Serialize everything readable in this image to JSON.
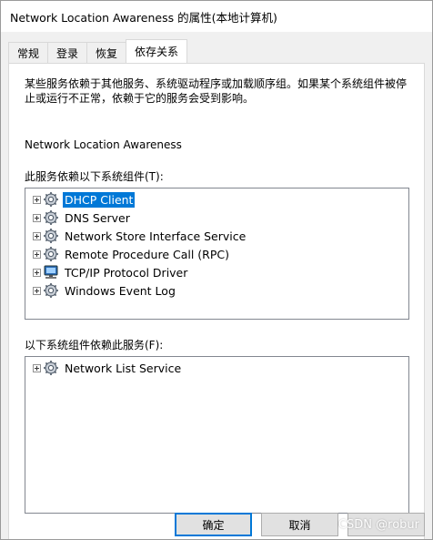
{
  "window": {
    "title": "Network Location Awareness 的属性(本地计算机)"
  },
  "tabs": [
    {
      "label": "常规",
      "active": false
    },
    {
      "label": "登录",
      "active": false
    },
    {
      "label": "恢复",
      "active": false
    },
    {
      "label": "依存关系",
      "active": true
    }
  ],
  "dependencies_tab": {
    "description": "某些服务依赖于其他服务、系统驱动程序或加载顺序组。如果某个系统组件被停止或运行不正常，依赖于它的服务会受到影响。",
    "service_name": "Network Location Awareness",
    "depends_on_label": "此服务依赖以下系统组件(T):",
    "depends_on": [
      {
        "label": "DHCP Client",
        "icon": "gear-service-icon",
        "selected": true
      },
      {
        "label": "DNS Server",
        "icon": "gear-service-icon",
        "selected": false
      },
      {
        "label": "Network Store Interface Service",
        "icon": "gear-service-icon",
        "selected": false
      },
      {
        "label": "Remote Procedure Call (RPC)",
        "icon": "gear-service-icon",
        "selected": false
      },
      {
        "label": "TCP/IP Protocol Driver",
        "icon": "computer-driver-icon",
        "selected": false
      },
      {
        "label": "Windows Event Log",
        "icon": "gear-service-icon",
        "selected": false
      }
    ],
    "dependents_label": "以下系统组件依赖此服务(F):",
    "dependents": [
      {
        "label": "Network List Service",
        "icon": "gear-service-icon",
        "selected": false
      }
    ]
  },
  "buttons": {
    "ok": "确定",
    "cancel": "取消"
  },
  "watermark": "CSDN @robur",
  "colors": {
    "selection": "#0078d7",
    "tab_page": "#ffffff",
    "dialog_bg": "#f0f0f0"
  }
}
